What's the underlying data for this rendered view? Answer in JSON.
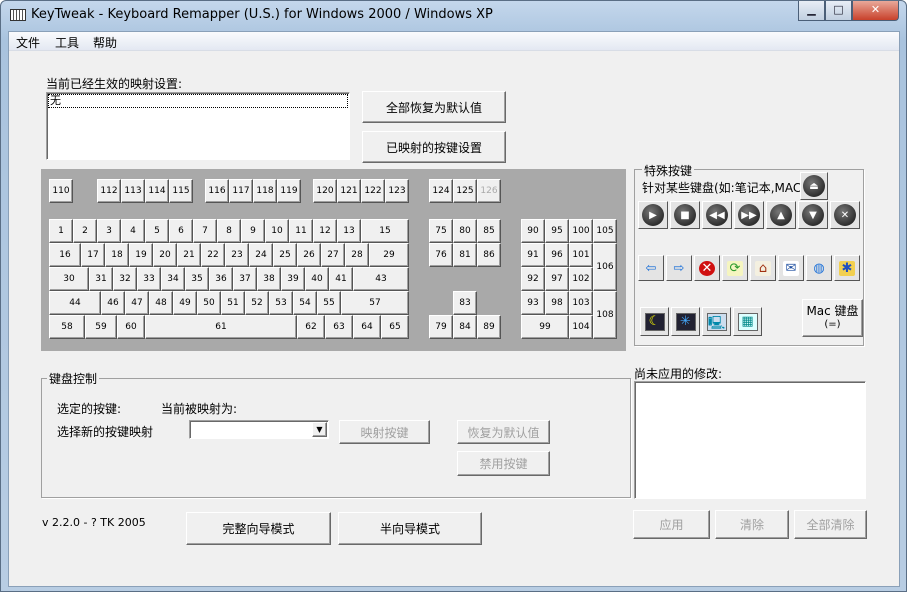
{
  "window": {
    "title": "KeyTweak -  Keyboard Remapper (U.S.)  for Windows 2000 / Windows XP",
    "controls": {
      "minimize": "▁",
      "maximize": "□",
      "close": "✕"
    }
  },
  "menu": [
    "文件",
    "工具",
    "帮助"
  ],
  "active": {
    "label": "当前已经生效的映射设置:",
    "items": [
      "无"
    ],
    "restore_all": "全部恢复为默认值",
    "show_mapped": "已映射的按键设置"
  },
  "keyboard": {
    "keys": [
      "110",
      "112",
      "113",
      "114",
      "115",
      "116",
      "117",
      "118",
      "119",
      "120",
      "121",
      "122",
      "123",
      "1",
      "2",
      "3",
      "4",
      "5",
      "6",
      "7",
      "8",
      "9",
      "10",
      "11",
      "12",
      "13",
      "15",
      "16",
      "17",
      "18",
      "19",
      "20",
      "21",
      "22",
      "23",
      "24",
      "25",
      "26",
      "27",
      "28",
      "29",
      "30",
      "31",
      "32",
      "33",
      "34",
      "35",
      "36",
      "37",
      "38",
      "39",
      "40",
      "41",
      "43",
      "44",
      "46",
      "47",
      "48",
      "49",
      "50",
      "51",
      "52",
      "53",
      "54",
      "55",
      "57",
      "58",
      "59",
      "60",
      "61",
      "62",
      "63",
      "64",
      "65",
      "124",
      "125",
      "126",
      "75",
      "80",
      "85",
      "76",
      "81",
      "86",
      "83",
      "79",
      "84",
      "89",
      "90",
      "95",
      "100",
      "105",
      "91",
      "96",
      "101",
      "106",
      "92",
      "97",
      "102",
      "93",
      "98",
      "103",
      "108",
      "99",
      "104"
    ],
    "disabled": [
      "126"
    ]
  },
  "special": {
    "title": "特殊按键",
    "subtitle": "针对某些键盘(如:笔记本,MAC)",
    "eject": "eject-icon",
    "media": [
      "play-icon",
      "stop-icon",
      "rewind-icon",
      "fast-forward-icon",
      "volume-up-icon",
      "volume-down-icon",
      "mute-icon"
    ],
    "nav": [
      "back-icon",
      "forward-icon",
      "stop-browser-icon",
      "refresh-icon",
      "home-icon",
      "mail-icon",
      "web-icon",
      "favorites-icon"
    ],
    "power": [
      "sleep-icon",
      "wake-icon",
      "my-computer-icon",
      "calculator-icon"
    ],
    "mac_button": "Mac 键盘",
    "mac_sub": "(=)"
  },
  "control": {
    "group": "键盘控制",
    "selected_key": "选定的按键:",
    "mapped_as": "当前被映射为:",
    "choose_new": "选择新的按键映射",
    "combo_value": "",
    "remap": "映射按键",
    "restore": "恢复为默认值",
    "disable": "禁用按键"
  },
  "pending": {
    "label": "尚未应用的修改:",
    "apply": "应用",
    "clear": "清除",
    "clear_all": "全部清除"
  },
  "footer": {
    "version": "v 2.2.0 - ? TK 2005",
    "full_teach": "完整向导模式",
    "half_teach": "半向导模式"
  }
}
